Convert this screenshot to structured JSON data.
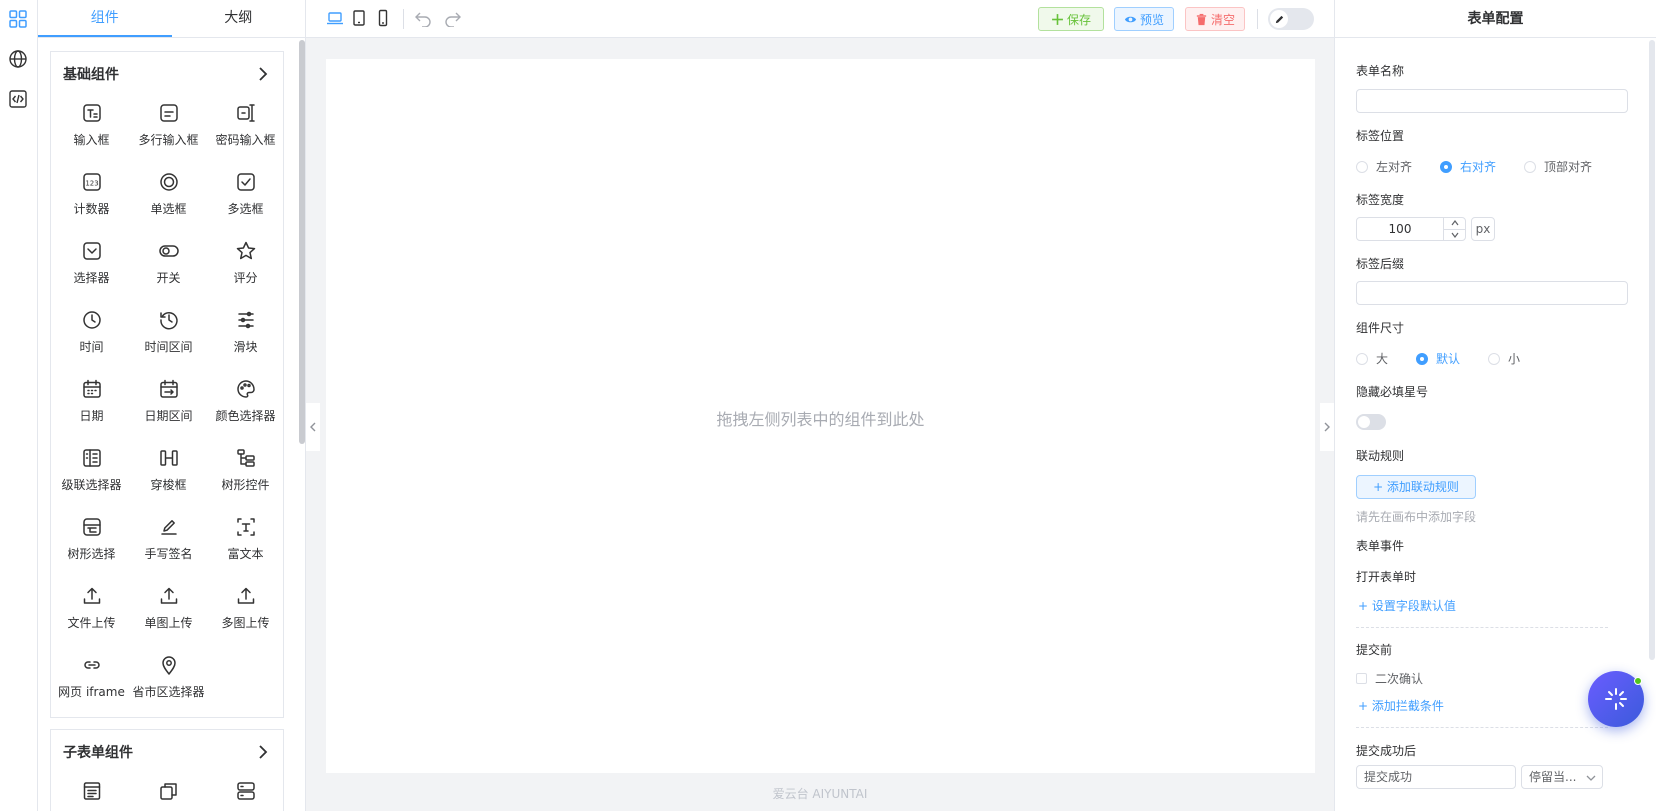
{
  "rail": {
    "items": [
      "grid-icon",
      "globe-icon",
      "code-icon"
    ]
  },
  "left_panel": {
    "tabs": [
      {
        "label": "组件",
        "active": true
      },
      {
        "label": "大纲",
        "active": false
      }
    ],
    "groups": [
      {
        "title": "基础组件",
        "items": [
          {
            "label": "输入框",
            "icon": "text-input-icon"
          },
          {
            "label": "多行输入框",
            "icon": "textarea-icon"
          },
          {
            "label": "密码输入框",
            "icon": "password-input-icon"
          },
          {
            "label": "计数器",
            "icon": "counter-icon"
          },
          {
            "label": "单选框",
            "icon": "radio-icon"
          },
          {
            "label": "多选框",
            "icon": "checkbox-icon"
          },
          {
            "label": "选择器",
            "icon": "select-icon"
          },
          {
            "label": "开关",
            "icon": "switch-icon"
          },
          {
            "label": "评分",
            "icon": "star-icon"
          },
          {
            "label": "时间",
            "icon": "clock-icon"
          },
          {
            "label": "时间区间",
            "icon": "time-range-icon"
          },
          {
            "label": "滑块",
            "icon": "slider-icon"
          },
          {
            "label": "日期",
            "icon": "calendar-icon"
          },
          {
            "label": "日期区间",
            "icon": "date-range-icon"
          },
          {
            "label": "颜色选择器",
            "icon": "palette-icon"
          },
          {
            "label": "级联选择器",
            "icon": "cascader-icon"
          },
          {
            "label": "穿梭框",
            "icon": "transfer-icon"
          },
          {
            "label": "树形控件",
            "icon": "tree-icon"
          },
          {
            "label": "树形选择",
            "icon": "tree-select-icon"
          },
          {
            "label": "手写签名",
            "icon": "signature-icon"
          },
          {
            "label": "富文本",
            "icon": "rich-text-icon"
          },
          {
            "label": "文件上传",
            "icon": "upload-icon"
          },
          {
            "label": "单图上传",
            "icon": "upload-icon"
          },
          {
            "label": "多图上传",
            "icon": "upload-icon"
          },
          {
            "label": "网页 iframe",
            "icon": "link-icon"
          },
          {
            "label": "省市区选择器",
            "icon": "location-pin-icon"
          }
        ]
      },
      {
        "title": "子表单组件",
        "items": [
          {
            "label": "",
            "icon": "sub-table-icon"
          },
          {
            "label": "",
            "icon": "copy-icon"
          },
          {
            "label": "",
            "icon": "group-icon"
          }
        ]
      }
    ]
  },
  "toolbar": {
    "devices": [
      "laptop-icon",
      "tablet-icon",
      "phone-icon"
    ],
    "save_label": "保存",
    "preview_label": "预览",
    "clear_label": "清空"
  },
  "canvas": {
    "empty_hint": "拖拽左侧列表中的组件到此处",
    "footer": "爱云台 AIYUNTAI"
  },
  "right_panel": {
    "title": "表单配置",
    "form_name_label": "表单名称",
    "label_position_label": "标签位置",
    "label_position_options": [
      "左对齐",
      "右对齐",
      "顶部对齐"
    ],
    "label_position_selected": "右对齐",
    "label_width_label": "标签宽度",
    "label_width_value": "100",
    "label_width_unit": "px",
    "label_suffix_label": "标签后缀",
    "size_label": "组件尺寸",
    "size_options": [
      "大",
      "默认",
      "小"
    ],
    "size_selected": "默认",
    "hide_required_label": "隐藏必填星号",
    "hide_required_on": false,
    "linkage_label": "联动规则",
    "add_linkage_button": "+ 添加联动规则",
    "linkage_hint": "请先在画布中添加字段",
    "events_label": "表单事件",
    "on_open_label": "打开表单时",
    "set_default_link": "+ 设置字段默认值",
    "before_submit_label": "提交前",
    "confirm_label": "二次确认",
    "add_intercept_link": "+ 添加拦截条件",
    "after_submit_label": "提交成功后",
    "success_message": "提交成功",
    "after_action": "停留当..."
  },
  "colors": {
    "accent": "#409eff",
    "success": "#67c23a",
    "danger": "#f56c6c",
    "fab": "#3b5bdb"
  }
}
